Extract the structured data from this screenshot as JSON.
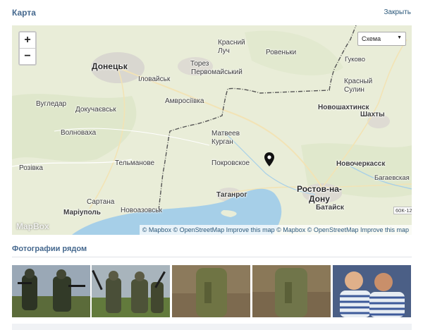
{
  "header": {
    "title": "Карта",
    "close_label": "Закрыть"
  },
  "map": {
    "zoom_in_label": "+",
    "zoom_out_label": "−",
    "layer_select": "Схема",
    "logo": "MapBox",
    "attribution": "© Mapbox © OpenStreetMap Improve this map © Mapbox © OpenStreetMap Improve this map",
    "cities": {
      "krasnyi_luch": "Красний\nЛуч",
      "rovenki": "Ровеньки",
      "gukovo": "Гуково",
      "donetsk": "Донецьк",
      "torez": "Торез",
      "pervomaiskyi": "Первомайський",
      "ilovaisk": "Іловайськ",
      "krasnyi_sulin": "Красный\nСулин",
      "amvrosiivka": "Амвросіївка",
      "vuhledar": "Вугледар",
      "dokuchaievsk": "Докучаєвськ",
      "novoshakhtinsk": "Новошахтинск",
      "shakhty": "Шахты",
      "volnovakha": "Волноваха",
      "matveev_kurgan": "Матвеев\nКурган",
      "pokrovskoe": "Покровское",
      "novocherkassk": "Новочеркасск",
      "telmanove": "Тельманове",
      "rozivka": "Розівка",
      "bagaevskaya": "Багаевская",
      "taganrog": "Таганрог",
      "rostov": "Ростов-на-\nДону",
      "bataysk": "Батайск",
      "sartana": "Сартана",
      "mariupol": "Маріуполь",
      "novoazovsk": "Новоазовськ",
      "road_label": "60К-12"
    }
  },
  "photos": {
    "title": "Фотографии рядом"
  },
  "colors": {
    "accent": "#45688e",
    "link": "#2b587a",
    "sea": "#a6cfe8",
    "land": "#e8ecd6",
    "border": "#555555"
  }
}
